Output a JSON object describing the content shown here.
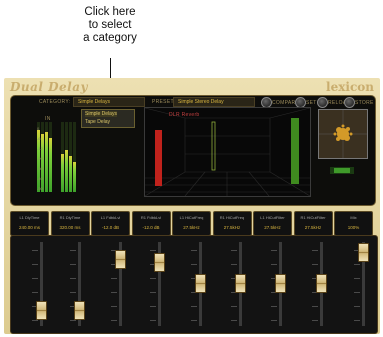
{
  "callout": {
    "text_line1": "Click here",
    "text_line2": "to select",
    "text_line3": "a category"
  },
  "plugin": {
    "title": "Dual Delay",
    "brand": "lexicon"
  },
  "header": {
    "category_label": "CATEGORY:",
    "category_value": "Simple Delays",
    "preset_label": "PRESET:",
    "preset_value": "Simple Stereo Delay",
    "compare_label": "COMPARE",
    "set_label": "SET",
    "reload_label": "RELOAD",
    "store_label": "STORE"
  },
  "dropdown": {
    "options": [
      "Simple Delays",
      "Tape Delay"
    ]
  },
  "display": {
    "meter_in_label": "IN",
    "stage_text": "DLR Reverb"
  },
  "meters": {
    "scale": [
      "0",
      "-6",
      "-12",
      "-20",
      "-30",
      "-40",
      "-50"
    ]
  },
  "params": [
    {
      "label": "L1 DlyTime",
      "value": "240.00 ms"
    },
    {
      "label": "R1 DlyTime",
      "value": "320.00 ms"
    },
    {
      "label": "L1 FdbkLvl",
      "value": "-12.0 dB"
    },
    {
      "label": "R1 FdbkLvl",
      "value": "-12.0 dB"
    },
    {
      "label": "L1 HiCutFreq",
      "value": "27.5kHz"
    },
    {
      "label": "R1 HiCutFreq",
      "value": "27.5kHz"
    },
    {
      "label": "L1 HiCutFilter",
      "value": "27.5kHz"
    },
    {
      "label": "R1 HiCutFilter",
      "value": "27.5kHz"
    },
    {
      "label": "Mix",
      "value": "100%"
    }
  ],
  "faders": {
    "levels": [
      0.12,
      0.12,
      0.88,
      0.84,
      0.52,
      0.52,
      0.52,
      0.52,
      0.98
    ]
  },
  "colors": {
    "gold": "#d9b640",
    "panel": "#e6d6a0"
  }
}
